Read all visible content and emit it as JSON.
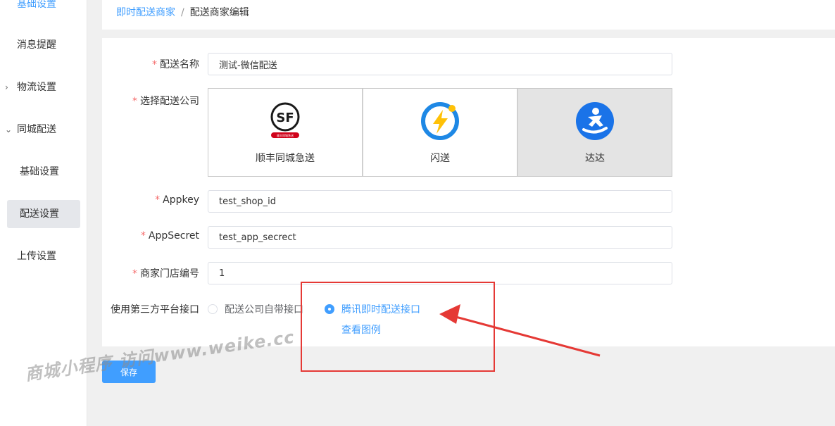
{
  "sidebar": {
    "items": [
      {
        "label": "基础设置",
        "state": "partial"
      },
      {
        "label": "消息提醒"
      },
      {
        "label": "物流设置",
        "chevron": "›"
      },
      {
        "label": "同城配送",
        "chevron": "⌄"
      },
      {
        "label": "基础设置",
        "sub": true
      },
      {
        "label": "配送设置",
        "sub": true,
        "active": true
      },
      {
        "label": "上传设置"
      }
    ]
  },
  "breadcrumb": {
    "parent": "即时配送商家",
    "separator": "/",
    "current": "配送商家编辑"
  },
  "form": {
    "name": {
      "label": "配送名称",
      "value": "测试-微信配送"
    },
    "company": {
      "label": "选择配送公司",
      "options": [
        {
          "name": "顺丰同城急送",
          "logo_text": "SF",
          "logo_sub": "顺丰同城急送",
          "icon": "sf-logo-icon"
        },
        {
          "name": "闪送",
          "icon": "shansong-logo-icon"
        },
        {
          "name": "达达",
          "icon": "dada-logo-icon",
          "selected": true
        }
      ]
    },
    "appkey": {
      "label": "Appkey",
      "value": "test_shop_id"
    },
    "appsecret": {
      "label": "AppSecret",
      "value": "test_app_secrect"
    },
    "shop_no": {
      "label": "商家门店编号",
      "value": "1"
    },
    "third_party": {
      "label": "使用第三方平台接口",
      "options": [
        {
          "label": "配送公司自带接口",
          "checked": false
        },
        {
          "label": "腾讯即时配送接口",
          "checked": true
        }
      ],
      "example_link": "查看图例"
    }
  },
  "save_label": "保存",
  "watermark": "商城小程序 访问www.weike.cc",
  "colors": {
    "primary": "#409eff",
    "required": "#f56c6c",
    "annotation": "#e53935",
    "selected_card": "#e4e4e4"
  }
}
